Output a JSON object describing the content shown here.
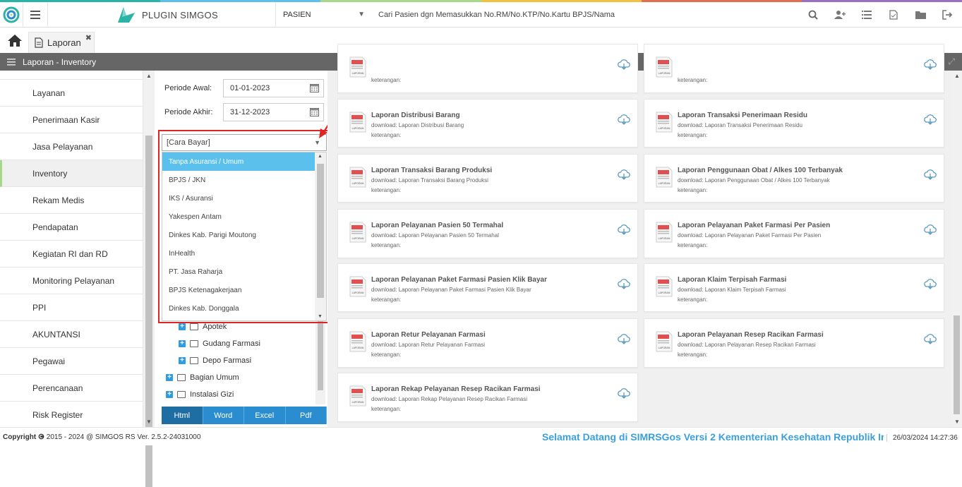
{
  "colors": {
    "brand_teal": "#2bb3a5",
    "accent_blue": "#2a8dd0",
    "selected_option": "#5bc0eb",
    "highlight_red": "#e02424",
    "header_gray": "#666666",
    "marquee_blue": "#3aa0dc"
  },
  "topbar": {
    "app_name": "PLUGIN SIMGOS",
    "patient_mode": "PASIEN",
    "search_placeholder": "Cari Pasien dgn Memasukkan No.RM/No.KTP/No.Kartu BPJS/Nama",
    "icons": [
      "search-icon",
      "add-user-icon",
      "list-icon",
      "document-icon",
      "folder-icon",
      "logout-icon"
    ]
  },
  "tabs": [
    {
      "label": "Laporan",
      "icon": "document-icon"
    }
  ],
  "section": {
    "title": "Laporan - Inventory"
  },
  "sidebar": {
    "items": [
      {
        "label": "Layanan"
      },
      {
        "label": "Penerimaan Kasir"
      },
      {
        "label": "Jasa Pelayanan"
      },
      {
        "label": "Inventory",
        "active": true
      },
      {
        "label": "Rekam Medis"
      },
      {
        "label": "Pendapatan"
      },
      {
        "label": "Kegiatan RI dan RD"
      },
      {
        "label": "Monitoring Pelayanan"
      },
      {
        "label": "PPI"
      },
      {
        "label": "AKUNTANSI"
      },
      {
        "label": "Pegawai"
      },
      {
        "label": "Perencanaan"
      },
      {
        "label": "Risk Register"
      }
    ]
  },
  "filters": {
    "periode_awal_label": "Periode Awal:",
    "periode_awal_value": "01-01-2023",
    "periode_akhir_label": "Periode Akhir:",
    "periode_akhir_value": "31-12-2023",
    "cara_bayar_placeholder": "[Cara Bayar]",
    "cara_bayar_options": [
      "Tanpa Asuransi / Umum",
      "BPJS / JKN",
      "IKS / Asuransi",
      "Yakespen Antam",
      "Dinkes Kab. Parigi Moutong",
      "InHealth",
      "PT. Jasa Raharja",
      "BPJS Ketenagakerjaan",
      "Dinkes Kab. Donggala"
    ],
    "selected_option_index": 0,
    "tree": [
      {
        "label": "Apotek",
        "level": 1
      },
      {
        "label": "Gudang Farmasi",
        "level": 1
      },
      {
        "label": "Depo Farmasi",
        "level": 1
      },
      {
        "label": "Bagian Umum",
        "level": 0
      },
      {
        "label": "Instalasi Gizi",
        "level": 0
      }
    ],
    "formats": [
      "Html",
      "Word",
      "Excel",
      "Pdf"
    ],
    "active_format": "Html"
  },
  "reports": {
    "ket_label": "keterangan:",
    "pdf_badge": "LAPORAN",
    "items": [
      {
        "title": "",
        "download": ""
      },
      {
        "title": "",
        "download": ""
      },
      {
        "title": "Laporan Distribusi Barang",
        "download": "download: Laporan Distribusi Barang"
      },
      {
        "title": "Laporan Transaksi Penerimaan Residu",
        "download": "download: Laporan Transaksi Penerimaan Residu"
      },
      {
        "title": "Laporan Transaksi Barang Produksi",
        "download": "download: Laporan Transaksi Barang Produksi"
      },
      {
        "title": "Laporan Penggunaan Obat / Alkes 100 Terbanyak",
        "download": "download: Laporan Penggunaan Obat / Alkes 100 Terbanyak"
      },
      {
        "title": "Laporan Pelayanan Pasien 50 Termahal",
        "download": "download: Laporan Pelayanan Pasien 50 Termahal"
      },
      {
        "title": "Laporan Pelayanan Paket Farmasi Per Pasien",
        "download": "download: Laporan Pelayanan Paket Farmasi Per Pasien"
      },
      {
        "title": "Laporan Pelayanan Paket Farmasi Pasien Klik Bayar",
        "download": "download: Laporan Pelayanan Paket Farmasi Pasien Klik Bayar"
      },
      {
        "title": "Laporan Klaim Terpisah Farmasi",
        "download": "download: Laporan Klaim Terpisah Farmasi"
      },
      {
        "title": "Laporan Retur Pelayanan Farmasi",
        "download": "download: Laporan Retur Pelayanan Farmasi"
      },
      {
        "title": "Laporan Pelayanan Resep Racikan Farmasi",
        "download": "download: Laporan Pelayanan Resep Racikan Farmasi"
      },
      {
        "title": "Laporan Rekap Pelayanan Resep Racikan Farmasi",
        "download": "download: Laporan Rekap Pelayanan Resep Racikan Farmasi"
      }
    ]
  },
  "footer": {
    "copyright_label": "Copyright",
    "copyright_text": "2015 - 2024 @ SIMGOS RS Ver. 2.5.2-24031000",
    "marquee": "Selamat Datang di SIMRSGos Versi 2 Kementerian Kesehatan Republik In",
    "datetime": "26/03/2024 14:27:36"
  }
}
